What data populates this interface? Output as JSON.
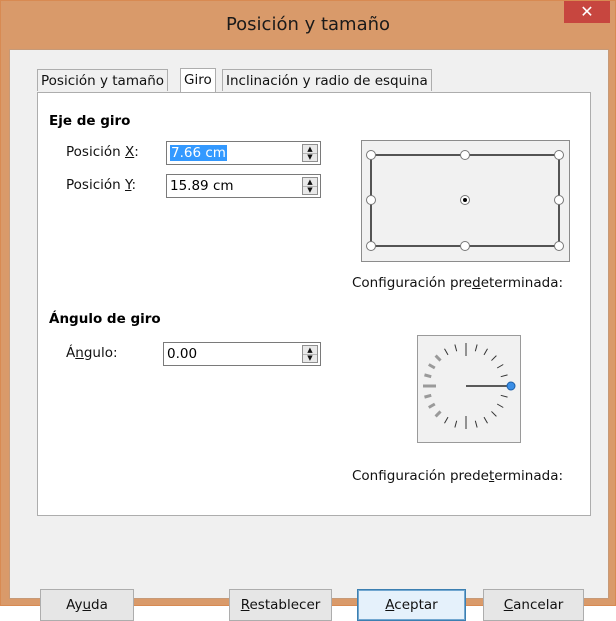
{
  "window": {
    "title": "Posición y tamaño",
    "close_glyph": "✕"
  },
  "tabs": [
    {
      "label": "Posición y tamaño",
      "active": false
    },
    {
      "label": "Giro",
      "active": true
    },
    {
      "label": "Inclinación y radio de esquina",
      "active": false
    }
  ],
  "pivot": {
    "heading": "Eje de giro",
    "pos_x_label_a": "Posición ",
    "pos_x_label_u": "X",
    "pos_x_label_b": ":",
    "pos_x_value": "7.66 cm",
    "pos_y_label_a": "Posición ",
    "pos_y_label_u": "Y",
    "pos_y_label_b": ":",
    "pos_y_value": "15.89 cm",
    "preset_caption_a": "Configuración pre",
    "preset_caption_u": "d",
    "preset_caption_b": "eterminada:"
  },
  "rotation": {
    "heading": "Ángulo de giro",
    "angle_label_a": "Á",
    "angle_label_u": "n",
    "angle_label_b": "gulo:",
    "angle_value": "0.00",
    "preset_caption_a": "Configuración prede",
    "preset_caption_u": "t",
    "preset_caption_b": "erminada:"
  },
  "buttons": {
    "help_a": "Ay",
    "help_u": "u",
    "help_b": "da",
    "reset_u": "R",
    "reset_b": "establecer",
    "ok_u": "A",
    "ok_b": "ceptar",
    "cancel_u": "C",
    "cancel_b": "ancelar"
  },
  "icons": {
    "spin_up": "▲",
    "spin_down": "▼"
  },
  "colors": {
    "titlebar": "#d99a6a",
    "close_button": "#c7463f",
    "selection": "#3399ff",
    "tab_marker": "#e02020",
    "dial_knob": "#3a8ee6"
  }
}
